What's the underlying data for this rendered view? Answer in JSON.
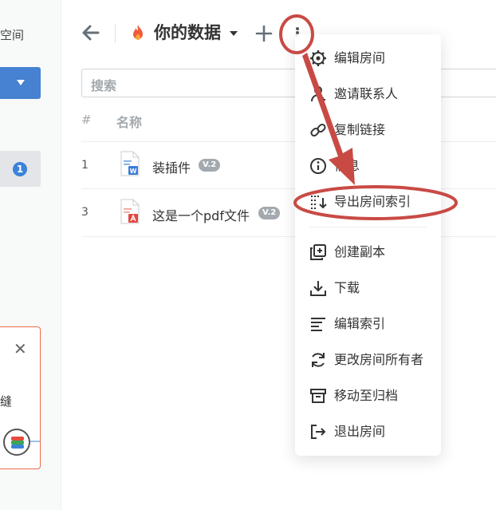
{
  "sidebar": {
    "space_label": "空间",
    "badge_count": "1",
    "promo_close": "✕",
    "promo_text": "缝"
  },
  "header": {
    "back_icon": "arrow-left-icon",
    "room_icon": "flame-icon",
    "room_title": "你的数据",
    "add_icon": "plus-icon",
    "more_icon": "vertical-dots-icon"
  },
  "search": {
    "placeholder": "搜索"
  },
  "table": {
    "columns": [
      "#",
      "名称"
    ],
    "rows": [
      {
        "num": "1",
        "name": "装插件",
        "version": "V.2",
        "file_type": "docx"
      },
      {
        "num": "3",
        "name": "这是一个pdf文件",
        "version": "V.2",
        "file_type": "pdf"
      }
    ]
  },
  "menu": {
    "items": [
      {
        "label": "编辑房间",
        "icon": "gear-icon"
      },
      {
        "label": "邀请联系人",
        "icon": "add-person-icon"
      },
      {
        "label": "复制链接",
        "icon": "link-icon"
      },
      {
        "label": "信息",
        "icon": "info-icon"
      },
      {
        "label": "导出房间索引",
        "icon": "export-index-icon"
      },
      {
        "label": "创建副本",
        "icon": "duplicate-icon"
      },
      {
        "label": "下载",
        "icon": "download-icon"
      },
      {
        "label": "编辑索引",
        "icon": "edit-index-icon"
      },
      {
        "label": "更改房间所有者",
        "icon": "refresh-owner-icon"
      },
      {
        "label": "移动至归档",
        "icon": "archive-icon"
      },
      {
        "label": "退出房间",
        "icon": "exit-icon"
      }
    ]
  },
  "colors": {
    "accent_blue": "#4781d1",
    "annotation_red": "#c94a45",
    "badge_grey": "#a3a9ae"
  }
}
